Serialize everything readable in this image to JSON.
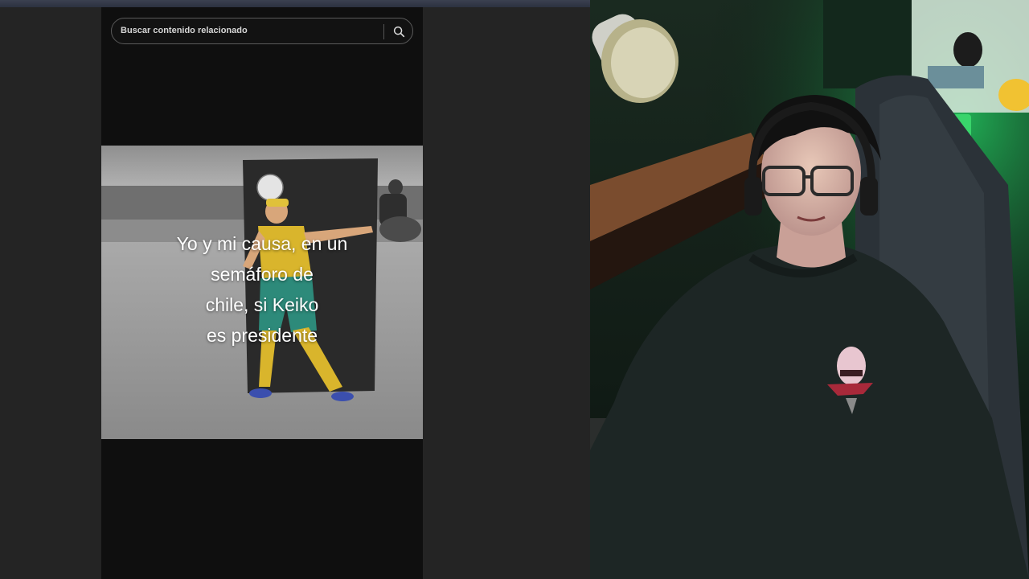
{
  "search": {
    "placeholder": "Buscar contenido relacionado"
  },
  "video": {
    "caption": "Yo y mi causa, en un\nsemáforo de\nchile, si Keiko\nes presidente"
  },
  "icons": {
    "search": "search-icon"
  },
  "colors": {
    "page_background": "#232323",
    "feed_background": "#0f0f0f",
    "ambient_light": "#22c55e"
  }
}
